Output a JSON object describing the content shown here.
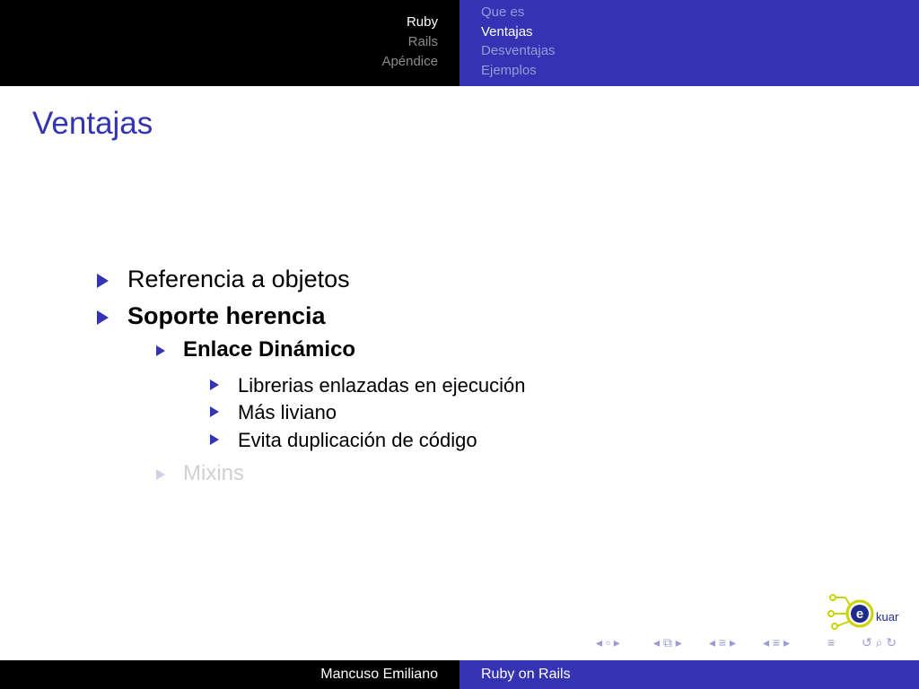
{
  "header": {
    "sections": [
      {
        "label": "Ruby",
        "active": true
      },
      {
        "label": "Rails",
        "active": false
      },
      {
        "label": "Apéndice",
        "active": false
      }
    ],
    "subsections": [
      {
        "label": "Que es",
        "active": false
      },
      {
        "label": "Ventajas",
        "active": true
      },
      {
        "label": "Desventajas",
        "active": false
      },
      {
        "label": "Ejemplos",
        "active": false
      }
    ]
  },
  "slide": {
    "title": "Ventajas",
    "items": [
      {
        "text": "Referencia a objetos",
        "level": 1,
        "bold": false,
        "dimmed": false
      },
      {
        "text": "Soporte herencia",
        "level": 1,
        "bold": true,
        "dimmed": false
      },
      {
        "text": "Enlace Dinámico",
        "level": 2,
        "bold": true,
        "dimmed": false
      },
      {
        "text": "Librerias enlazadas en ejecución",
        "level": 3,
        "bold": false,
        "dimmed": false
      },
      {
        "text": "Más liviano",
        "level": 3,
        "bold": false,
        "dimmed": false
      },
      {
        "text": "Evita duplicación de código",
        "level": 3,
        "bold": false,
        "dimmed": false
      },
      {
        "text": "Mixins",
        "level": 2,
        "bold": false,
        "dimmed": true
      }
    ]
  },
  "logo": {
    "text": "kuar",
    "letter": "e",
    "icon": "ekuar-logo-icon"
  },
  "footer": {
    "author": "Mancuso Emiliano",
    "short_title": "Ruby on Rails"
  },
  "colors": {
    "accent": "#3333b3",
    "dark_bar": "#000000",
    "logo_green": "#c8d400",
    "logo_blue": "#1e2a8c"
  }
}
